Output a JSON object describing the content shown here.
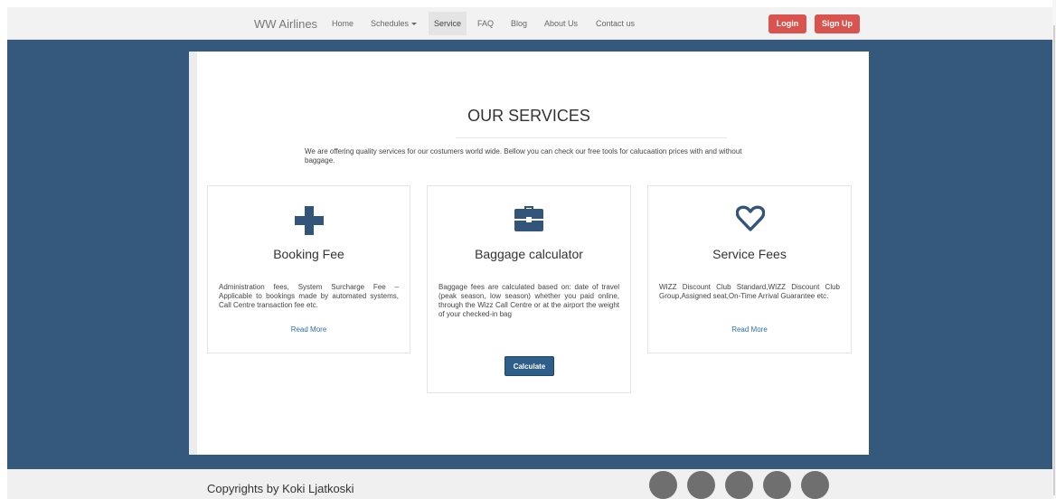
{
  "navbar": {
    "brand": "WW Airlines",
    "items": [
      {
        "label": "Home"
      },
      {
        "label": "Schedules"
      },
      {
        "label": "Service"
      },
      {
        "label": "FAQ"
      },
      {
        "label": "Blog"
      },
      {
        "label": "About Us"
      },
      {
        "label": "Contact us"
      }
    ],
    "login_label": "Login",
    "signup_label": "Sign Up"
  },
  "services": {
    "title": "OUR SERVICES",
    "intro": "We are offering quality services for our costumers world wide. Bellow you can check our free tools for calucaation prices with and without baggage.",
    "cards": [
      {
        "icon": "plus-icon",
        "title": "Booking Fee",
        "text": "Administration fees, System Surcharge Fee – Applicable to bookings made by automated systems, Call Centre transaction fee etc.",
        "link": "Read More"
      },
      {
        "icon": "briefcase-icon",
        "title": "Baggage calculator",
        "text": "Baggage fees are calculated based on: date of travel (peak season, low season) whether you paid online, through the Wizz Call Centre or at the airport the weight of your checked-in bag",
        "button": "Calculate"
      },
      {
        "icon": "heart-icon",
        "title": "Service Fees",
        "text": "WIZZ Discount Club Standard,WIZZ Discount Club Group,Assigned seat,On-Time Arrival Guarantee etc.",
        "link": "Read More"
      }
    ]
  },
  "footer": {
    "copyright": "Copyrights by Koki Ljatkoski",
    "social_count": 5
  },
  "colors": {
    "main_bg": "#35587d",
    "accent_red": "#d9534f",
    "button_blue": "#2e5f8a",
    "icon_blue": "#34557a",
    "link_blue": "#2a6fb0"
  }
}
